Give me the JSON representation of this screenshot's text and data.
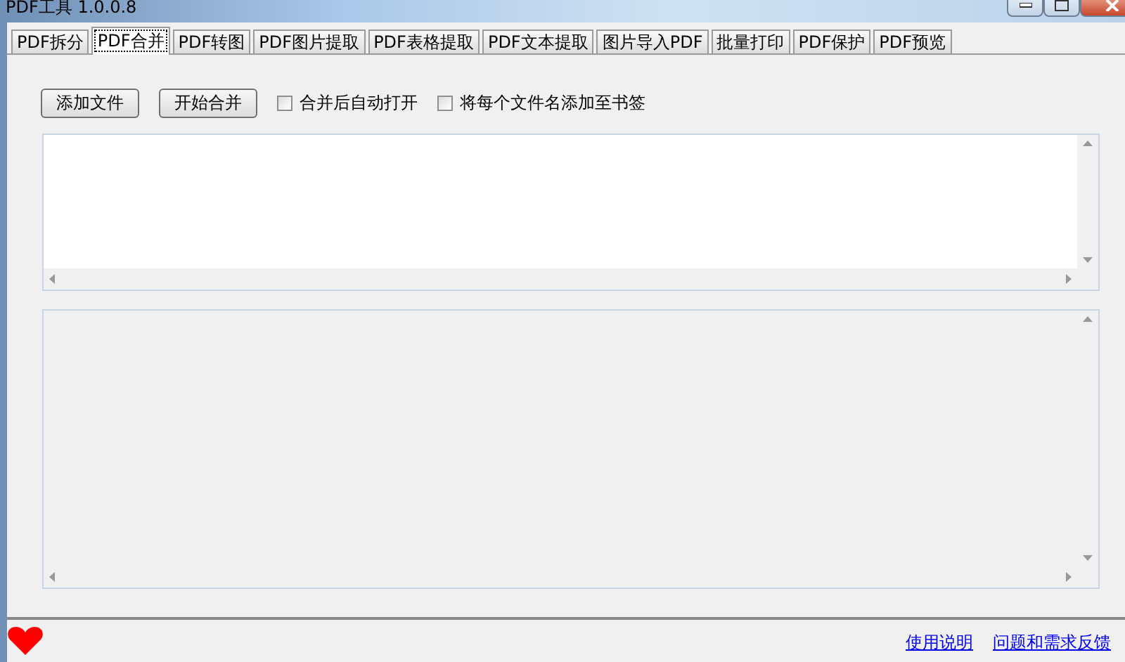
{
  "window": {
    "title": "PDF工具 1.0.0.8"
  },
  "tabs": [
    {
      "label": "PDF拆分",
      "selected": false
    },
    {
      "label": "PDF合并",
      "selected": true
    },
    {
      "label": "PDF转图",
      "selected": false
    },
    {
      "label": "PDF图片提取",
      "selected": false
    },
    {
      "label": "PDF表格提取",
      "selected": false
    },
    {
      "label": "PDF文本提取",
      "selected": false
    },
    {
      "label": "图片导入PDF",
      "selected": false
    },
    {
      "label": "批量打印",
      "selected": false
    },
    {
      "label": "PDF保护",
      "selected": false
    },
    {
      "label": "PDF预览",
      "selected": false
    }
  ],
  "toolbar": {
    "buttons": [
      "添加文件",
      "开始合并"
    ],
    "checkboxes": [
      {
        "label": "合并后自动打开",
        "checked": false
      },
      {
        "label": "将每个文件名添加至书签",
        "checked": false
      }
    ]
  },
  "status_bar": {
    "links": [
      "使用说明",
      "问题和需求反馈"
    ]
  }
}
